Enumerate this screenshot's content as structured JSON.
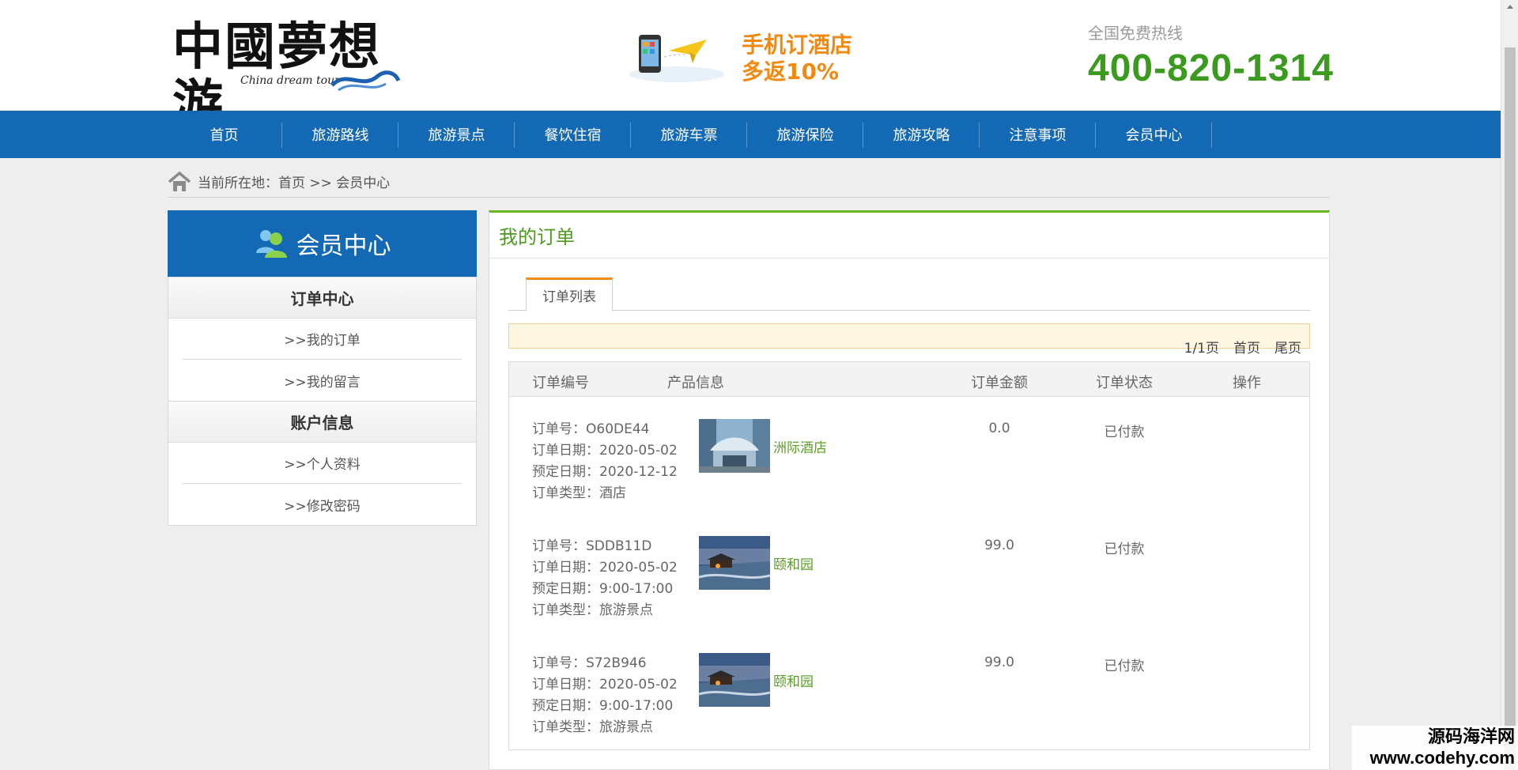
{
  "header": {
    "logo_text": "中國夢想游",
    "logo_sub": "China dream tour",
    "promo_line1": "手机订酒店",
    "promo_line2": "多返10%",
    "hotline_label": "全国免费热线",
    "hotline_number": "400-820-1314"
  },
  "nav": {
    "items": [
      "首页",
      "旅游路线",
      "旅游景点",
      "餐饮住宿",
      "旅游车票",
      "旅游保险",
      "旅游攻略",
      "注意事项",
      "会员中心"
    ]
  },
  "breadcrumb": {
    "text": "当前所在地：首页 >> 会员中心"
  },
  "sidebar": {
    "title": "会员中心",
    "sections": [
      {
        "heading": "订单中心",
        "items": [
          ">>我的订单",
          ">>我的留言"
        ]
      },
      {
        "heading": "账户信息",
        "items": [
          ">>个人资料",
          ">>修改密码"
        ]
      }
    ]
  },
  "main": {
    "title": "我的订单",
    "tab": "订单列表",
    "pager": {
      "page": "1/1页",
      "first": "首页",
      "last": "尾页"
    },
    "columns": [
      "订单编号",
      "产品信息",
      "订单金额",
      "订单状态",
      "操作"
    ],
    "orders": [
      {
        "no": "订单号：O60DE44",
        "date": "订单日期：2020-05-02",
        "reserve": "预定日期：2020-12-12",
        "type": "订单类型：酒店",
        "product": "洲际酒店",
        "amount": "0.0",
        "status": "已付款"
      },
      {
        "no": "订单号：SDDB11D",
        "date": "订单日期：2020-05-02",
        "reserve": "预定日期：9:00-17:00",
        "type": "订单类型：旅游景点",
        "product": "颐和园",
        "amount": "99.0",
        "status": "已付款"
      },
      {
        "no": "订单号：S72B946",
        "date": "订单日期：2020-05-02",
        "reserve": "预定日期：9:00-17:00",
        "type": "订单类型：旅游景点",
        "product": "颐和园",
        "amount": "99.0",
        "status": "已付款"
      }
    ]
  },
  "watermark": {
    "line1": "源码海洋网",
    "line2": "www.codehy.com"
  },
  "colors": {
    "nav_blue": "#1469b4",
    "green": "#4c9b1e",
    "orange": "#f08a13"
  }
}
